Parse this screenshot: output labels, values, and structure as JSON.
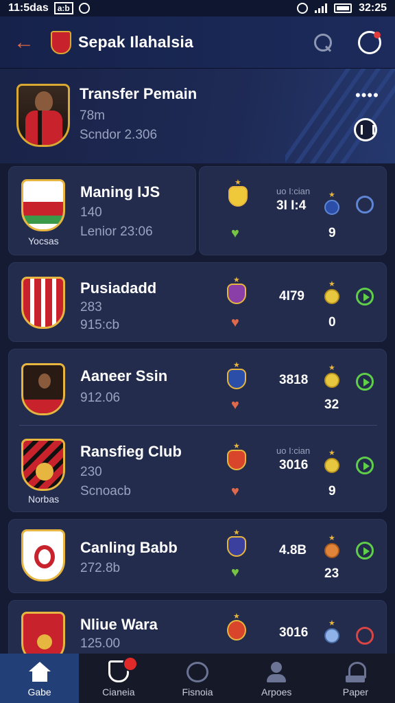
{
  "status_bar": {
    "time_left": "11:5das",
    "box_label": "a:b",
    "time_right": "32:25"
  },
  "header": {
    "title": "Sepak Ilahalsia"
  },
  "hero": {
    "title": "Transfer Pemain",
    "line1": "78m",
    "line2": "Scndor 2.306",
    "more": "••••"
  },
  "teams": [
    {
      "name": "Maning IJS",
      "sub1": "140",
      "sub2": "Lenior 23:06",
      "crest_caption": "Yocsas",
      "stat_caption": "uo I:cian",
      "stat": "3I I:4",
      "under": "9",
      "heart": "green"
    },
    {
      "name": "Pusiadadd",
      "sub1": "283",
      "sub2": "915:cb",
      "crest_caption": "",
      "stat_caption": "",
      "stat": "4I79",
      "under": "0",
      "heart": "orange"
    },
    {
      "name": "Aaneer Ssin",
      "sub1": "912.06",
      "sub2": "",
      "crest_caption": "",
      "stat_caption": "",
      "stat": "3818",
      "under": "32",
      "heart": "orange"
    },
    {
      "name": "Ransfieg Club",
      "sub1": "230",
      "sub2": "Scnoacb",
      "crest_caption": "Norbas",
      "stat_caption": "uo I:cian",
      "stat": "3016",
      "under": "9",
      "heart": "orange"
    },
    {
      "name": "Canling Babb",
      "sub1": "272.8b",
      "sub2": "",
      "crest_caption": "",
      "stat_caption": "",
      "stat": "4.8B",
      "under": "23",
      "heart": "green"
    },
    {
      "name": "Nliue Wara",
      "sub1": "125.00",
      "sub2": "",
      "crest_caption": "",
      "stat_caption": "",
      "stat": "3016",
      "under": "",
      "heart": ""
    }
  ],
  "nav": [
    {
      "label": "Gabe",
      "icon": "home-icon"
    },
    {
      "label": "Cianeia",
      "icon": "shield-icon"
    },
    {
      "label": "Fisnoia",
      "icon": "target-icon"
    },
    {
      "label": "Arpoes",
      "icon": "person-icon"
    },
    {
      "label": "Paper",
      "icon": "paper-icon"
    }
  ],
  "colors": {
    "accent": "#233f78",
    "crest_gold": "#e7b640",
    "heart_orange": "#e0684b",
    "heart_green": "#76c442",
    "play_green": "#5fcf4a"
  }
}
